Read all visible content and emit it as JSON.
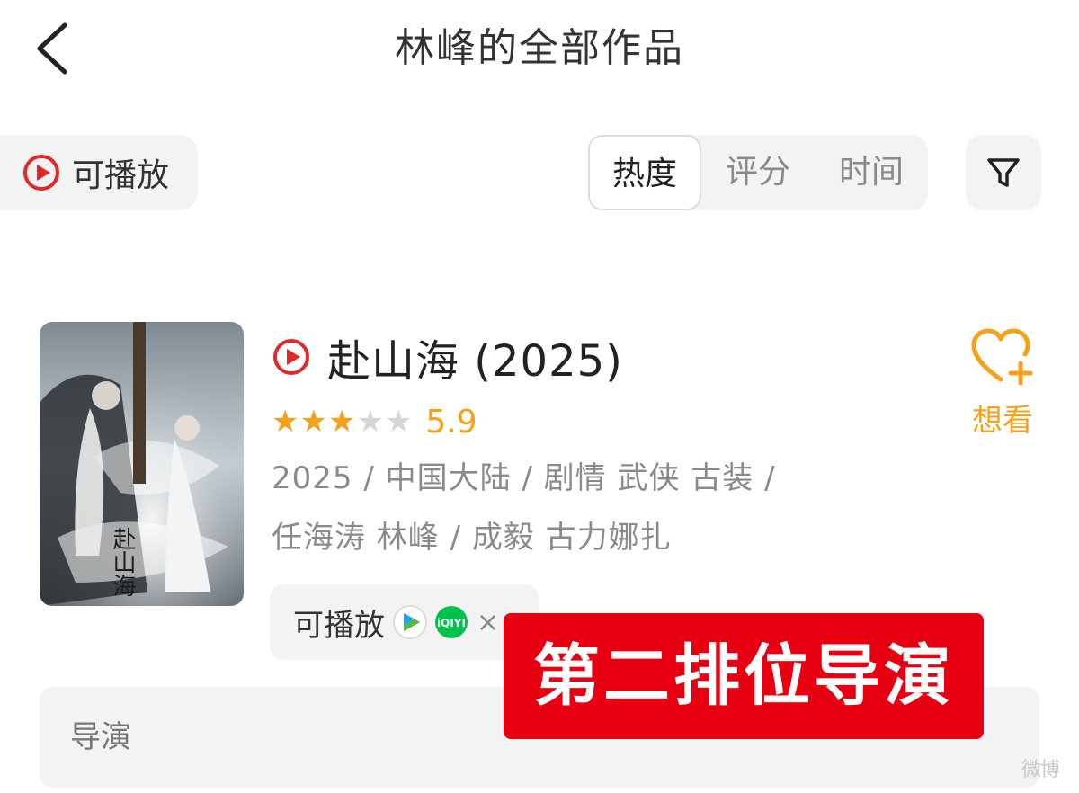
{
  "header": {
    "title": "林峰的全部作品"
  },
  "toolbar": {
    "playable_label": "可播放",
    "sort_tabs": [
      {
        "label": "热度",
        "active": true
      },
      {
        "label": "评分",
        "active": false
      },
      {
        "label": "时间",
        "active": false
      }
    ]
  },
  "work": {
    "title": "赴山海 (2025)",
    "rating": {
      "value": "5.9",
      "stars_filled": 3,
      "stars_total": 5
    },
    "meta_line1": "2025 / 中国大陆 / 剧情 武侠 古装 /",
    "meta_line2": "任海涛 林峰 / 成毅 古力娜扎",
    "want_label": "想看",
    "availability_label": "可播放",
    "availability_close": "×",
    "platform_icons": [
      "tencent-video-icon",
      "iqiyi-icon"
    ],
    "iqiyi_text": "iQIYI",
    "poster_text": "赴山海"
  },
  "role_section": {
    "label": "导演"
  },
  "overlay": {
    "banner_text": "第二排位导演"
  },
  "watermark": {
    "text": "微博"
  },
  "colors": {
    "accent": "#f7a11a",
    "play_red": "#e02a2a",
    "banner_red": "#e60012",
    "chip_bg": "#f3f3f3"
  }
}
